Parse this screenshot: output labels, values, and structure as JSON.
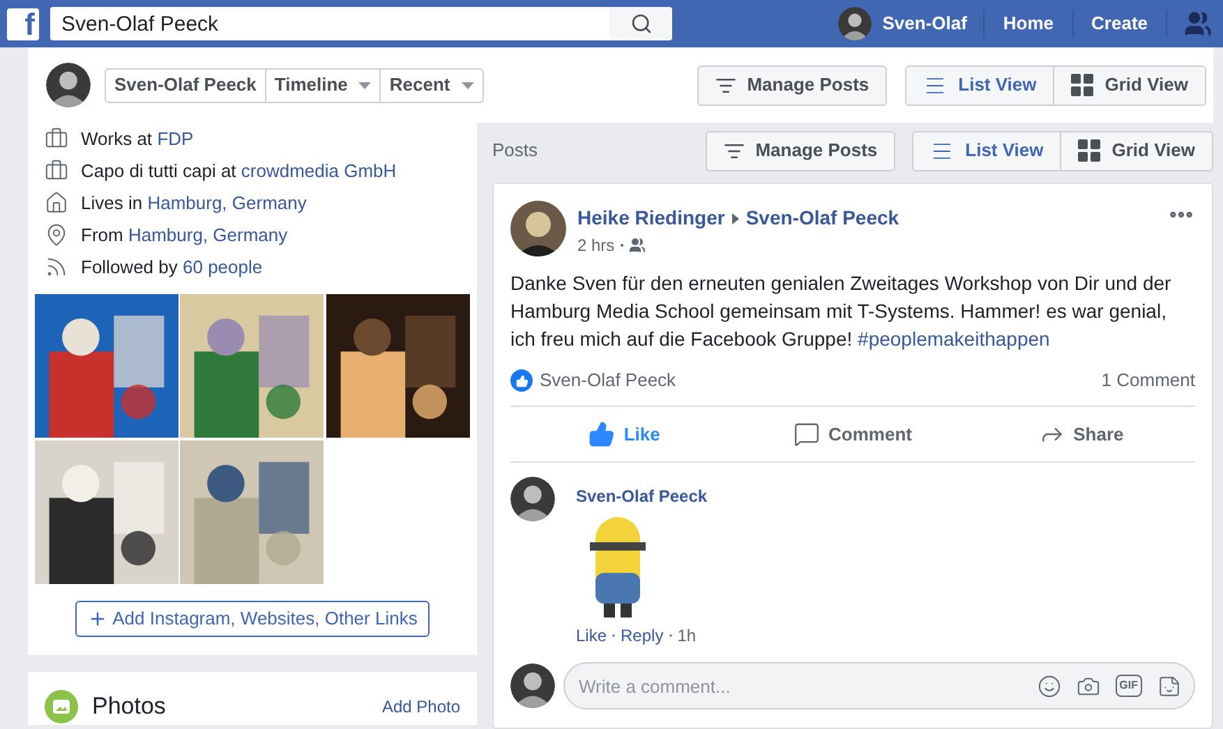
{
  "top_bar": {
    "logo": "f",
    "search_value": "Sven-Olaf Peeck",
    "profile_name": "Sven-Olaf",
    "nav": [
      "Home",
      "Create"
    ]
  },
  "profile_header": {
    "name": "Sven-Olaf Peeck",
    "menus": [
      "Timeline",
      "Recent"
    ],
    "manage": "Manage Posts",
    "views": [
      {
        "label": "List View",
        "selected": true,
        "kind": "list"
      },
      {
        "label": "Grid View",
        "selected": false,
        "kind": "grid"
      }
    ]
  },
  "intro": {
    "items": [
      {
        "kind": "work",
        "text": "Works at",
        "link": "FDP"
      },
      {
        "kind": "work",
        "text": "Capo di tutti capi at",
        "link": "crowdmedia GmbH"
      },
      {
        "kind": "home",
        "text": "Lives in",
        "link": "Hamburg, Germany"
      },
      {
        "kind": "from",
        "text": "From",
        "link": "Hamburg, Germany"
      },
      {
        "kind": "followers",
        "text": "Followed by",
        "link": "60 people"
      }
    ],
    "add_links": "Add Instagram, Websites, Other Links"
  },
  "photos_card": {
    "title": "Photos",
    "action": "Add Photo"
  },
  "posts": {
    "title": "Posts",
    "manage": "Manage Posts",
    "views": [
      {
        "label": "List View",
        "selected": true,
        "kind": "list"
      },
      {
        "label": "Grid View",
        "selected": false,
        "kind": "grid"
      }
    ]
  },
  "post": {
    "author": "Heike Riedinger",
    "target": "Sven-Olaf Peeck",
    "time": "2 hrs",
    "text": "Danke Sven für den erneuten genialen Zweitages Workshop von Dir und der Hamburg Media School gemeinsam mit T-Systems. Hammer! es war genial, ich freu mich auf die Facebook Gruppe!",
    "hashtag": "#peoplemakeithappen",
    "liked_by": "Sven-Olaf Peeck",
    "comment_count": "1 Comment",
    "actions": [
      {
        "kind": "like",
        "label": "Like",
        "selected": true
      },
      {
        "kind": "comment",
        "label": "Comment",
        "selected": false
      },
      {
        "kind": "share",
        "label": "Share",
        "selected": false
      }
    ],
    "comment": {
      "author": "Sven-Olaf Peeck",
      "like": "Like",
      "reply": "Reply",
      "time": "1h"
    },
    "comment_box": {
      "placeholder": "Write a comment...",
      "gif": "GIF"
    }
  }
}
